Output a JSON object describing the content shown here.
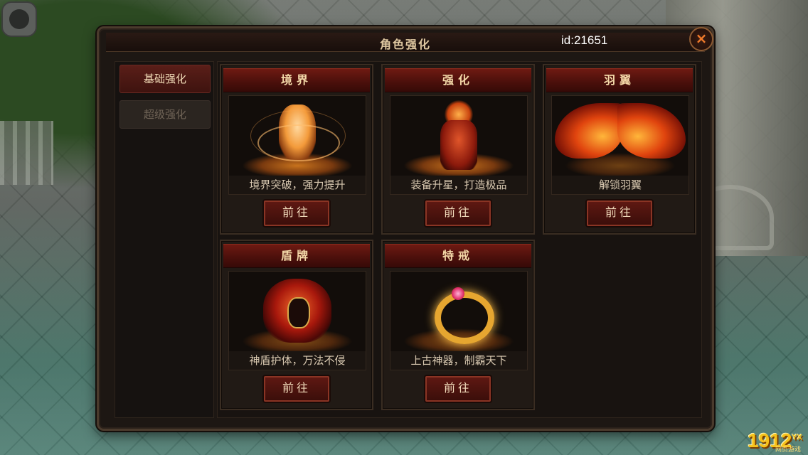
{
  "window": {
    "title": "角色强化",
    "user_id": "id:21651",
    "close_label": "×"
  },
  "sidebar": {
    "items": [
      {
        "label": "基础强化",
        "active": true
      },
      {
        "label": "超级强化",
        "active": false
      }
    ]
  },
  "cards": [
    {
      "title": "境界",
      "description": "境界突破，强力提升",
      "button": "前往",
      "icon": "meditating-figure-icon"
    },
    {
      "title": "强化",
      "description": "装备升星，打造极品",
      "button": "前往",
      "icon": "armored-warrior-icon"
    },
    {
      "title": "羽翼",
      "description": "解锁羽翼",
      "button": "前往",
      "icon": "flame-wings-icon"
    },
    {
      "title": "盾牌",
      "description": "神盾护体，万法不侵",
      "button": "前往",
      "icon": "demon-shield-icon"
    },
    {
      "title": "特戒",
      "description": "上古神器，制霸天下",
      "button": "前往",
      "icon": "gem-ring-icon"
    }
  ],
  "logo": {
    "text": "1912",
    "badge": "YX",
    "subtitle": "网页游戏"
  },
  "colors": {
    "panel_bg": "#1d1713",
    "ribbon_red": "#6e1a12",
    "title_gold": "#f3d8a8",
    "close_orange": "#f07a2a"
  }
}
